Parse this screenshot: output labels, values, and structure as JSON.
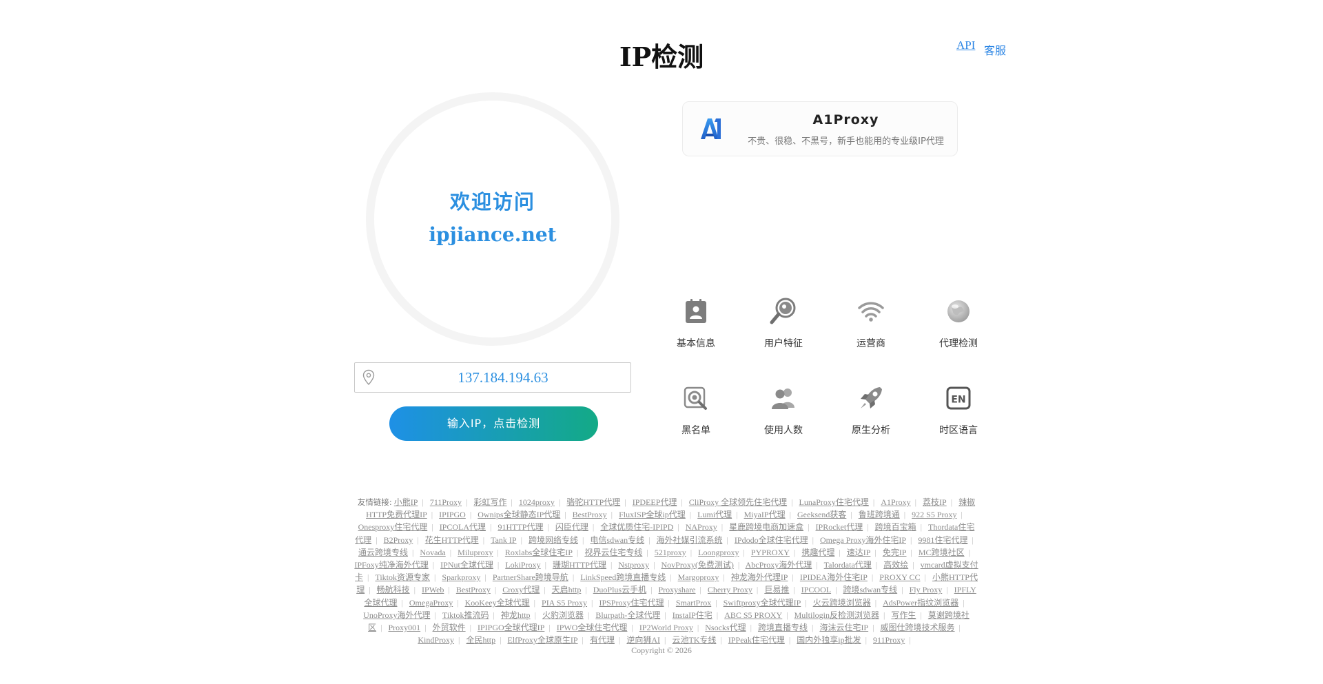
{
  "header": {
    "title": "IP检测",
    "api_link": "API",
    "service_link": "客服"
  },
  "hero": {
    "welcome": "欢迎访问",
    "domain": "ipjiance.net"
  },
  "ip_input": {
    "value": "137.184.194.63",
    "icon": "location-pin-icon"
  },
  "check_button": "输入IP，点击检测",
  "ad": {
    "name": "A1Proxy",
    "desc": "不贵、很稳、不黑号，新手也能用的专业级IP代理",
    "logo": "a1-logo"
  },
  "features": [
    {
      "label": "基本信息",
      "icon": "contact-card-icon"
    },
    {
      "label": "用户特征",
      "icon": "magnifier-icon"
    },
    {
      "label": "运营商",
      "icon": "wifi-icon"
    },
    {
      "label": "代理检测",
      "icon": "globe-icon"
    },
    {
      "label": "黑名单",
      "icon": "search-target-icon"
    },
    {
      "label": "使用人数",
      "icon": "users-icon"
    },
    {
      "label": "原生分析",
      "icon": "rocket-icon"
    },
    {
      "label": "时区语言",
      "icon": "en-language-icon"
    }
  ],
  "friend_links": {
    "lead": "友情链接:",
    "items": [
      "小熊IP",
      "711Proxy",
      "彩虹写作",
      "1024proxy",
      "骆驼HTTP代理",
      "IPDEEP代理",
      "CliProxy 全球领先住宅代理",
      "LunaProxy住宅代理",
      "A1Proxy",
      "荔枝IP",
      "辣椒HTTP免费代理IP",
      "IPIPGO",
      "Ownips全球静态IP代理",
      "BestProxy",
      "FluxISP全球ip代理",
      "Lumi代理",
      "MiyaIP代理",
      "Geeksend获客",
      "鲁班跨境通",
      "922 S5 Proxy",
      "Onesproxy住宅代理",
      "IPCOLA代理",
      "91HTTP代理",
      "闪臣代理",
      "全球优质住宅-IPIPD",
      "NAProxy",
      "星鹿跨境电商加速盒",
      "IPRocket代理",
      "跨境百宝箱",
      "Thordata住宅代理",
      "B2Proxy",
      "花生HTTP代理",
      "Tank IP",
      "跨境网络专线",
      "电信sdwan专线",
      "海外社媒引流系统",
      "IPdodo全球住宅代理",
      "Omega Proxy海外住宅IP",
      "9981住宅代理",
      "通云跨境专线",
      "Novada",
      "Miluproxy",
      "Roxlabs全球住宅IP",
      "视界云住宅专线",
      "521proxy",
      "Loongproxy",
      "PYPROXY",
      "携趣代理",
      "速达IP",
      "免完IP",
      "MC跨境社区",
      "IPFoxy纯净海外代理",
      "IPNut全球代理",
      "LokiProxy",
      "珊瑚HTTP代理",
      "Nstproxy",
      "NovProxy(免费测试)",
      "AbcProxy海外代理",
      "Talordata代理",
      "高效绘",
      "vmcard虚拟支付卡",
      "Tiktok资源专家",
      "Sparkproxy",
      "PartnerShare跨境导航",
      "LinkSpeed跨境直播专线",
      "Margoproxy",
      "神龙海外代理IP",
      "IPIDEA海外住宅IP",
      "PROXY CC",
      "小熊HTTP代理",
      "畅航科技",
      "IPWeb",
      "BestProxy",
      "Croxy代理",
      "天启http",
      "DuoPlus云手机",
      "Proxyshare",
      "Cherry Proxy",
      "巨易推",
      "IPCOOL",
      "跨境sdwan专线",
      "Fly Proxy",
      "IPFLY全球代理",
      "OmegaProxy",
      "KooKeey全球代理",
      "PIA S5 Proxy",
      "IPSProxy住宅代理",
      "SmartProx",
      "Swiftproxy全球代理IP",
      "火云跨境浏览器",
      "AdsPower指纹浏览器",
      "UnoProxy海外代理",
      "Tiktok推流码",
      "神龙http",
      "火豹浏览器",
      "Blurpath-全球代理",
      "InstaIP住宅",
      "ABC S5 PROXY",
      "Multilogin反检测浏览器",
      "写作生",
      "莫谢跨境社区",
      "Proxy001",
      "外贸软件",
      "IPIPGO全球代理IP",
      "IPWO全球住宅代理",
      "IP2World Proxy",
      "Nsocks代理",
      "跨境直播专线",
      "海沫云住宅IP",
      "威图仕跨境技术服务",
      "KindProxy",
      "全民http",
      "ElfProxy全球原生IP",
      "有代理",
      "逆向狮AI",
      "云池TK专线",
      "IPPeak住宅代理",
      "国内外独享ip批发",
      "911Proxy"
    ]
  },
  "copyright": "Copyright © 2026",
  "colors": {
    "accent": "#2b8fe0",
    "button_start": "#1e90e6",
    "button_end": "#13aa86"
  }
}
